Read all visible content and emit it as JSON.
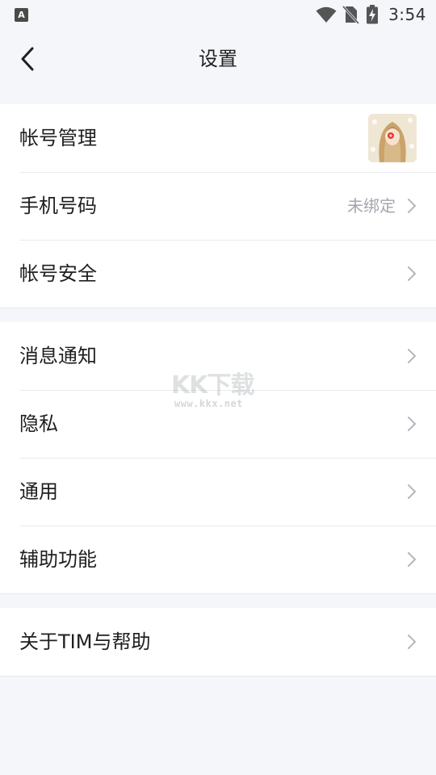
{
  "status_bar": {
    "left_icon": "A",
    "time": "3:54",
    "icons": [
      "wifi-icon",
      "no-sim-icon",
      "battery-charging-icon"
    ]
  },
  "nav": {
    "back_icon": "chevron-left-icon",
    "title": "设置"
  },
  "groups": [
    {
      "items": [
        {
          "label": "帐号管理",
          "trailing": "avatar"
        },
        {
          "label": "手机号码",
          "value": "未绑定",
          "trailing": "chevron"
        },
        {
          "label": "帐号安全",
          "trailing": "chevron"
        }
      ]
    },
    {
      "items": [
        {
          "label": "消息通知",
          "trailing": "chevron"
        },
        {
          "label": "隐私",
          "trailing": "chevron"
        },
        {
          "label": "通用",
          "trailing": "chevron"
        },
        {
          "label": "辅助功能",
          "trailing": "chevron"
        }
      ]
    },
    {
      "items": [
        {
          "label": "关于TIM与帮助",
          "trailing": "chevron"
        }
      ]
    }
  ],
  "watermark": {
    "logo_text": "KK下载",
    "url": "www.kkx.net"
  },
  "colors": {
    "background": "#f5f6fa",
    "row_background": "#ffffff",
    "divider": "#e9eaee",
    "secondary_text": "#a3a6ad",
    "chevron": "#b3b6bd"
  }
}
